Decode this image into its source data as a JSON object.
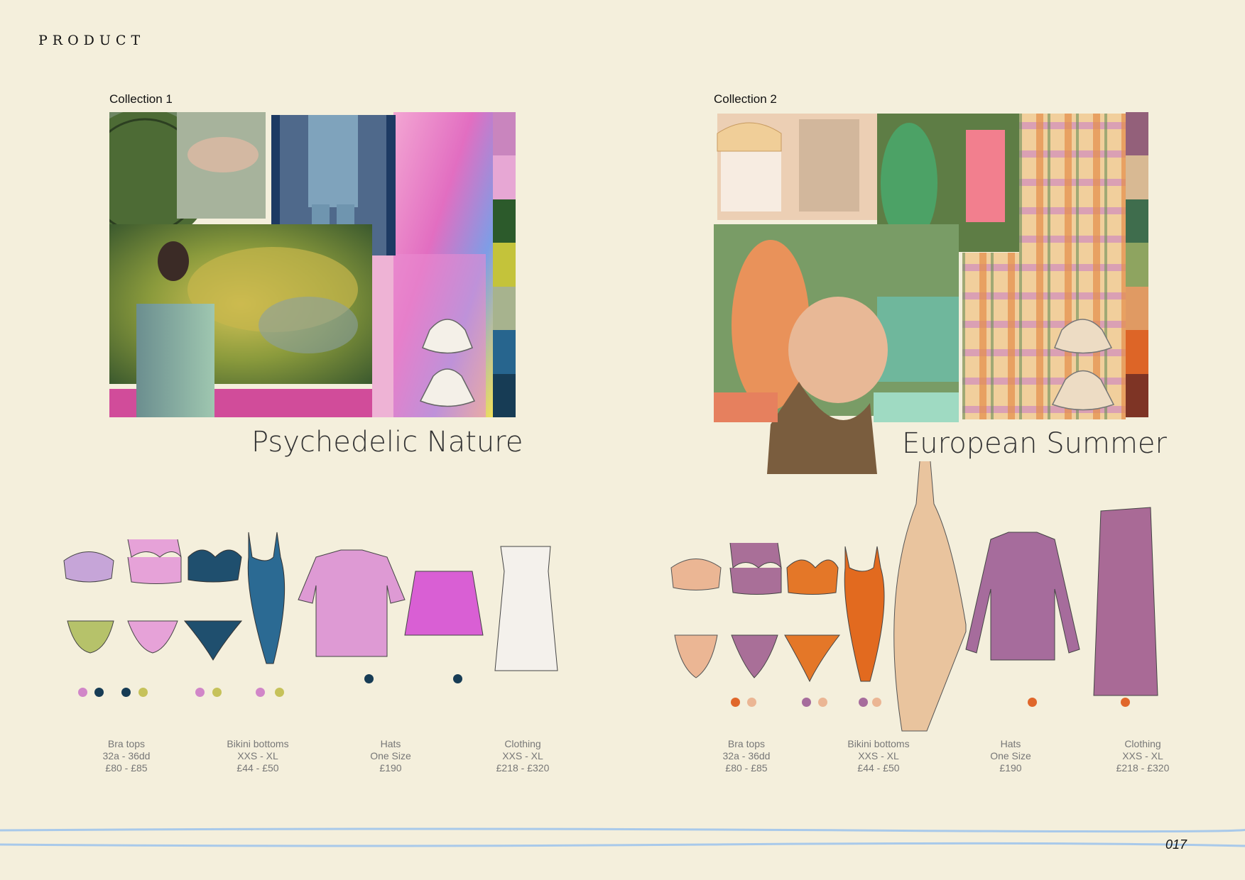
{
  "page": {
    "heading": "PRODUCT",
    "page_number": "017"
  },
  "collections": [
    {
      "label": "Collection 1",
      "title": "Psychedelic Nature",
      "palette": [
        "#c985be",
        "#e7a7d4",
        "#2c5a2b",
        "#c4c33a",
        "#a7b38e",
        "#27658e",
        "#173c55"
      ],
      "info": [
        {
          "name": "Bra tops",
          "size": "32a - 36dd",
          "price": "£80 - £85"
        },
        {
          "name": "Bikini bottoms",
          "size": "XXS - XL",
          "price": "£44 - £50"
        },
        {
          "name": "Hats",
          "size": "One Size",
          "price": "£190"
        },
        {
          "name": "Clothing",
          "size": "XXS - XL",
          "price": "£218 - £320"
        }
      ]
    },
    {
      "label": "Collection 2",
      "title": "European Summer",
      "palette": [
        "#93607a",
        "#d8b993",
        "#3f6d4d",
        "#8ea460",
        "#e09a63",
        "#dd6527",
        "#7e3425"
      ],
      "info": [
        {
          "name": "Bra tops",
          "size": "32a - 36dd",
          "price": "£80 - £85"
        },
        {
          "name": "Bikini bottoms",
          "size": "XXS - XL",
          "price": "£44 - £50"
        },
        {
          "name": "Hats",
          "size": "One Size",
          "price": "£190"
        },
        {
          "name": "Clothing",
          "size": "XXS - XL",
          "price": "£218 - £320"
        }
      ]
    }
  ]
}
